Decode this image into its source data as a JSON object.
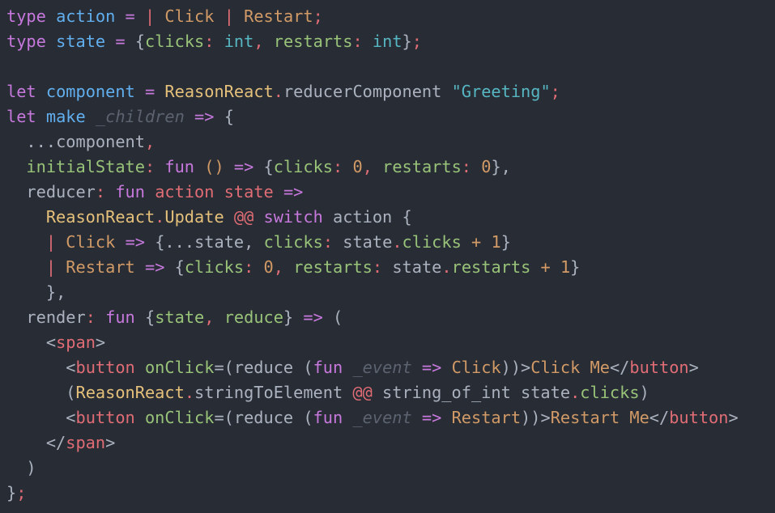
{
  "editor": {
    "language": "reason",
    "theme_colors": {
      "background": "#282c34",
      "keyword": "#c678dd",
      "function": "#61afef",
      "type": "#e5c07b",
      "constructor": "#d19a66",
      "string": "#56b6c2",
      "field": "#98c379",
      "tag": "#e06c75",
      "comment": "#5c6370",
      "plain": "#abb2bf"
    },
    "lines": [
      [
        [
          "kw",
          "type"
        ],
        [
          "plain",
          " "
        ],
        [
          "fn",
          "action"
        ],
        [
          "plain",
          " "
        ],
        [
          "op",
          "="
        ],
        [
          "plain",
          " "
        ],
        [
          "pipe",
          "|"
        ],
        [
          "plain",
          " "
        ],
        [
          "ctor",
          "Click"
        ],
        [
          "plain",
          " "
        ],
        [
          "pipe",
          "|"
        ],
        [
          "plain",
          " "
        ],
        [
          "ctor",
          "Restart"
        ],
        [
          "semi",
          ";"
        ]
      ],
      [
        [
          "kw",
          "type"
        ],
        [
          "plain",
          " "
        ],
        [
          "fn",
          "state"
        ],
        [
          "plain",
          " "
        ],
        [
          "op",
          "="
        ],
        [
          "plain",
          " "
        ],
        [
          "punct",
          "{"
        ],
        [
          "fld",
          "clicks"
        ],
        [
          "colon",
          ":"
        ],
        [
          "plain",
          " "
        ],
        [
          "int",
          "int"
        ],
        [
          "colon",
          ","
        ],
        [
          "plain",
          " "
        ],
        [
          "fld",
          "restarts"
        ],
        [
          "colon",
          ":"
        ],
        [
          "plain",
          " "
        ],
        [
          "int",
          "int"
        ],
        [
          "punct",
          "}"
        ],
        [
          "semi",
          ";"
        ]
      ],
      [],
      [
        [
          "kw",
          "let"
        ],
        [
          "plain",
          " "
        ],
        [
          "fn",
          "component"
        ],
        [
          "plain",
          " "
        ],
        [
          "op",
          "="
        ],
        [
          "plain",
          " "
        ],
        [
          "ty",
          "ReasonReact"
        ],
        [
          "colon",
          "."
        ],
        [
          "plain",
          "reducerComponent"
        ],
        [
          "plain",
          " "
        ],
        [
          "str",
          "\"Greeting\""
        ],
        [
          "semi",
          ";"
        ]
      ],
      [
        [
          "kw",
          "let"
        ],
        [
          "plain",
          " "
        ],
        [
          "fn",
          "make"
        ],
        [
          "plain",
          " "
        ],
        [
          "comment",
          "_children"
        ],
        [
          "plain",
          " "
        ],
        [
          "op",
          "=>"
        ],
        [
          "plain",
          " "
        ],
        [
          "punct",
          "{"
        ]
      ],
      [
        [
          "plain",
          "  "
        ],
        [
          "plain",
          "..."
        ],
        [
          "plain",
          "component"
        ],
        [
          "colon",
          ","
        ]
      ],
      [
        [
          "plain",
          "  "
        ],
        [
          "fld",
          "initialState"
        ],
        [
          "colon",
          ":"
        ],
        [
          "plain",
          " "
        ],
        [
          "kw",
          "fun"
        ],
        [
          "plain",
          " "
        ],
        [
          "ctor",
          "()"
        ],
        [
          "plain",
          " "
        ],
        [
          "op",
          "=>"
        ],
        [
          "plain",
          " "
        ],
        [
          "punct",
          "{"
        ],
        [
          "fld",
          "clicks"
        ],
        [
          "colon",
          ":"
        ],
        [
          "plain",
          " "
        ],
        [
          "num",
          "0"
        ],
        [
          "colon",
          ","
        ],
        [
          "plain",
          " "
        ],
        [
          "fld",
          "restarts"
        ],
        [
          "colon",
          ":"
        ],
        [
          "plain",
          " "
        ],
        [
          "num",
          "0"
        ],
        [
          "punct",
          "}"
        ],
        [
          "punct",
          ","
        ]
      ],
      [
        [
          "plain",
          "  "
        ],
        [
          "plain",
          "reducer"
        ],
        [
          "colon",
          ":"
        ],
        [
          "plain",
          " "
        ],
        [
          "kw",
          "fun"
        ],
        [
          "plain",
          " "
        ],
        [
          "tag",
          "action"
        ],
        [
          "plain",
          " "
        ],
        [
          "tag",
          "state"
        ],
        [
          "plain",
          " "
        ],
        [
          "op",
          "=>"
        ]
      ],
      [
        [
          "plain",
          "    "
        ],
        [
          "ty",
          "ReasonReact"
        ],
        [
          "colon",
          "."
        ],
        [
          "ty",
          "Update"
        ],
        [
          "plain",
          " "
        ],
        [
          "pipe",
          "@@"
        ],
        [
          "plain",
          " "
        ],
        [
          "kw",
          "switch"
        ],
        [
          "plain",
          " "
        ],
        [
          "plain",
          "action"
        ],
        [
          "plain",
          " "
        ],
        [
          "punct",
          "{"
        ]
      ],
      [
        [
          "plain",
          "    "
        ],
        [
          "pipe",
          "|"
        ],
        [
          "plain",
          " "
        ],
        [
          "ctor",
          "Click"
        ],
        [
          "plain",
          " "
        ],
        [
          "op",
          "=>"
        ],
        [
          "plain",
          " "
        ],
        [
          "punct",
          "{"
        ],
        [
          "plain",
          "..."
        ],
        [
          "plain",
          "state"
        ],
        [
          "punct",
          ","
        ],
        [
          "plain",
          " "
        ],
        [
          "fld",
          "clicks"
        ],
        [
          "colon",
          ":"
        ],
        [
          "plain",
          " "
        ],
        [
          "plain",
          "state"
        ],
        [
          "colon",
          "."
        ],
        [
          "fld",
          "clicks"
        ],
        [
          "plain",
          " "
        ],
        [
          "ctor",
          "+"
        ],
        [
          "plain",
          " "
        ],
        [
          "num",
          "1"
        ],
        [
          "punct",
          "}"
        ]
      ],
      [
        [
          "plain",
          "    "
        ],
        [
          "pipe",
          "|"
        ],
        [
          "plain",
          " "
        ],
        [
          "ctor",
          "Restart"
        ],
        [
          "plain",
          " "
        ],
        [
          "op",
          "=>"
        ],
        [
          "plain",
          " "
        ],
        [
          "punct",
          "{"
        ],
        [
          "fld",
          "clicks"
        ],
        [
          "colon",
          ":"
        ],
        [
          "plain",
          " "
        ],
        [
          "num",
          "0"
        ],
        [
          "colon",
          ","
        ],
        [
          "plain",
          " "
        ],
        [
          "fld",
          "restarts"
        ],
        [
          "colon",
          ":"
        ],
        [
          "plain",
          " "
        ],
        [
          "plain",
          "state"
        ],
        [
          "colon",
          "."
        ],
        [
          "fld",
          "restarts"
        ],
        [
          "plain",
          " "
        ],
        [
          "ctor",
          "+"
        ],
        [
          "plain",
          " "
        ],
        [
          "num",
          "1"
        ],
        [
          "punct",
          "}"
        ]
      ],
      [
        [
          "plain",
          "    "
        ],
        [
          "punct",
          "}"
        ],
        [
          "punct",
          ","
        ]
      ],
      [
        [
          "plain",
          "  "
        ],
        [
          "plain",
          "render"
        ],
        [
          "colon",
          ":"
        ],
        [
          "plain",
          " "
        ],
        [
          "kw",
          "fun"
        ],
        [
          "plain",
          " "
        ],
        [
          "punct",
          "{"
        ],
        [
          "fld",
          "state"
        ],
        [
          "colon",
          ","
        ],
        [
          "plain",
          " "
        ],
        [
          "fld",
          "reduce"
        ],
        [
          "punct",
          "}"
        ],
        [
          "plain",
          " "
        ],
        [
          "op",
          "=>"
        ],
        [
          "plain",
          " "
        ],
        [
          "punct",
          "("
        ]
      ],
      [
        [
          "plain",
          "    "
        ],
        [
          "punct",
          "<"
        ],
        [
          "tag",
          "span"
        ],
        [
          "punct",
          ">"
        ]
      ],
      [
        [
          "plain",
          "      "
        ],
        [
          "punct",
          "<"
        ],
        [
          "tag",
          "button"
        ],
        [
          "plain",
          " "
        ],
        [
          "attr",
          "onClick"
        ],
        [
          "punct",
          "=("
        ],
        [
          "plain",
          "reduce"
        ],
        [
          "plain",
          " "
        ],
        [
          "punct",
          "("
        ],
        [
          "kw",
          "fun"
        ],
        [
          "plain",
          " "
        ],
        [
          "comment",
          "_event"
        ],
        [
          "plain",
          " "
        ],
        [
          "op",
          "=>"
        ],
        [
          "plain",
          " "
        ],
        [
          "ctor",
          "Click"
        ],
        [
          "punct",
          "))>"
        ],
        [
          "text",
          "Click Me"
        ],
        [
          "punct",
          "</"
        ],
        [
          "tag",
          "button"
        ],
        [
          "punct",
          ">"
        ]
      ],
      [
        [
          "plain",
          "      "
        ],
        [
          "punct",
          "("
        ],
        [
          "ty",
          "ReasonReact"
        ],
        [
          "colon",
          "."
        ],
        [
          "plain",
          "stringToElement"
        ],
        [
          "plain",
          " "
        ],
        [
          "pipe",
          "@@"
        ],
        [
          "plain",
          " "
        ],
        [
          "plain",
          "string_of_int"
        ],
        [
          "plain",
          " "
        ],
        [
          "plain",
          "state"
        ],
        [
          "colon",
          "."
        ],
        [
          "fld",
          "clicks"
        ],
        [
          "punct",
          ")"
        ]
      ],
      [
        [
          "plain",
          "      "
        ],
        [
          "punct",
          "<"
        ],
        [
          "tag",
          "button"
        ],
        [
          "plain",
          " "
        ],
        [
          "attr",
          "onClick"
        ],
        [
          "punct",
          "=("
        ],
        [
          "plain",
          "reduce"
        ],
        [
          "plain",
          " "
        ],
        [
          "punct",
          "("
        ],
        [
          "kw",
          "fun"
        ],
        [
          "plain",
          " "
        ],
        [
          "comment",
          "_event"
        ],
        [
          "plain",
          " "
        ],
        [
          "op",
          "=>"
        ],
        [
          "plain",
          " "
        ],
        [
          "ctor",
          "Restart"
        ],
        [
          "punct",
          "))>"
        ],
        [
          "text",
          "Restart Me"
        ],
        [
          "punct",
          "</"
        ],
        [
          "tag",
          "button"
        ],
        [
          "punct",
          ">"
        ]
      ],
      [
        [
          "plain",
          "    "
        ],
        [
          "punct",
          "</"
        ],
        [
          "tag",
          "span"
        ],
        [
          "punct",
          ">"
        ]
      ],
      [
        [
          "plain",
          "  "
        ],
        [
          "punct",
          ")"
        ]
      ],
      [
        [
          "punct",
          "}"
        ],
        [
          "semi",
          ";"
        ]
      ]
    ]
  }
}
